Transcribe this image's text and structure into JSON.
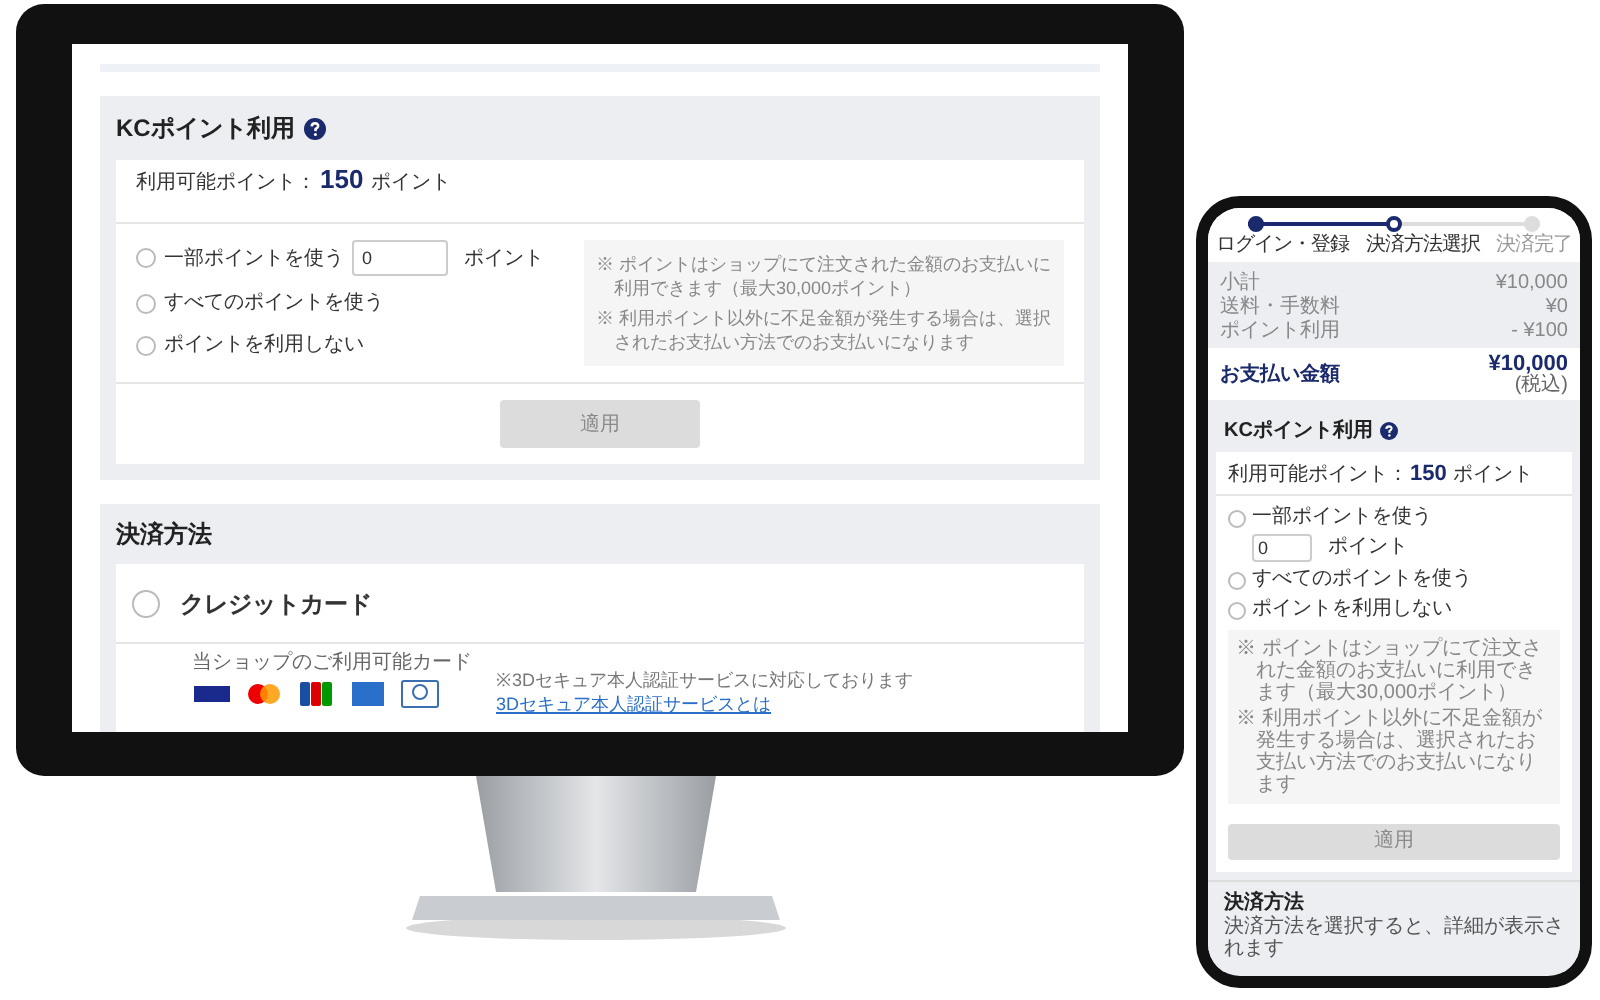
{
  "desktop": {
    "points_section": {
      "title": "KCポイント利用",
      "available_label": "利用可能ポイント：",
      "available_value": "150",
      "available_unit": "ポイント",
      "options": [
        {
          "kind": "amount",
          "label": "一部ポイントを使う",
          "selected": false,
          "input_value": "0",
          "unit": "ポイント"
        },
        {
          "kind": "plain",
          "label": "すべてのポイントを使う",
          "selected": false
        },
        {
          "kind": "plain",
          "label": "ポイントを利用しない",
          "selected": false
        }
      ],
      "notes": [
        "※ ポイントはショップにて注文された金額のお支払いに利用できます（最大30,000ポイント）",
        "※ 利用ポイント以外に不足金額が発生する場合は、選択されたお支払い方法でのお支払いになります"
      ],
      "apply_button": {
        "label": "適用",
        "disabled": true
      }
    },
    "payment_section": {
      "title": "決済方法",
      "methods": [
        {
          "label": "クレジットカード",
          "selected": false
        }
      ],
      "cards_label": "当ショップのご利用可能カード",
      "secure_note": "※3Dセキュア本人認証サービスに対応しております",
      "secure_link": "3Dセキュア本人認証サービスとは"
    }
  },
  "mobile": {
    "steps": [
      {
        "label": "ログイン・登録",
        "completed": true,
        "selected": false
      },
      {
        "label": "決済方法選択",
        "completed": false,
        "selected": true
      },
      {
        "label": "決済完了",
        "completed": false,
        "selected": false
      }
    ],
    "summary": [
      {
        "label": "小計",
        "value": "¥10,000"
      },
      {
        "label": "送料・手数料",
        "value": "¥0"
      },
      {
        "label": "ポイント利用",
        "value": "- ¥100"
      }
    ],
    "total": {
      "label": "お支払い金額",
      "value": "¥10,000",
      "tax_note": "(税込)"
    },
    "points_section": {
      "title": "KCポイント利用",
      "available_label": "利用可能ポイント：",
      "available_value": "150",
      "available_unit": "ポイント",
      "options": [
        {
          "kind": "amount",
          "label": "一部ポイントを使う",
          "selected": false,
          "input_value": "0",
          "unit": "ポイント"
        },
        {
          "kind": "plain",
          "label": "すべてのポイントを使う",
          "selected": false
        },
        {
          "kind": "plain",
          "label": "ポイントを利用しない",
          "selected": false
        }
      ],
      "notes": [
        "※ ポイントはショップにて注文された金額のお支払いに利用できます（最大30,000ポイント）",
        "※ 利用ポイント以外に不足金額が発生する場合は、選択されたお支払い方法でのお支払いになります"
      ],
      "apply_button": {
        "label": "適用",
        "disabled": true
      }
    },
    "payment_section": {
      "title": "決済方法",
      "description": "決済方法を選択すると、詳細が表示されます"
    }
  }
}
